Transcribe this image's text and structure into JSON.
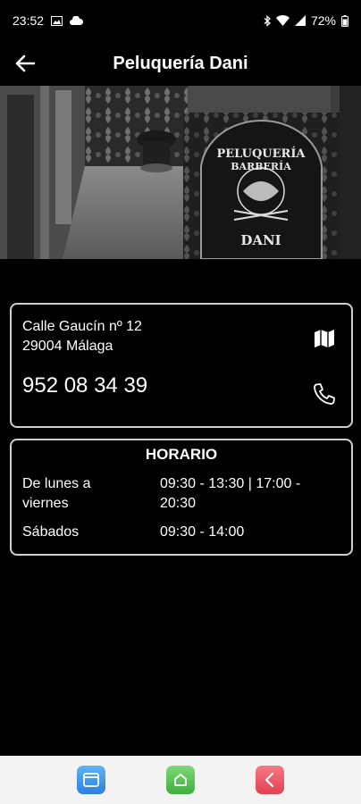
{
  "status_bar": {
    "time": "23:52",
    "battery": "72%",
    "icons": [
      "image-icon",
      "cloud-icon",
      "bluetooth-icon",
      "wifi-icon",
      "signal-icon",
      "battery-icon"
    ]
  },
  "app_bar": {
    "title": "Peluquería Dani",
    "back_icon": "arrow-left-icon"
  },
  "hero": {
    "sign_line1": "PELUQUERÍA",
    "sign_line2": "BARBERÍA",
    "sign_name": "DANI"
  },
  "contact": {
    "address_line1": "Calle Gaucín nº 12",
    "address_line2": "29004 Málaga",
    "phone": "952 08 34 39",
    "map_icon": "map-icon",
    "phone_icon": "phone-icon"
  },
  "schedule": {
    "title": "HORARIO",
    "rows": [
      {
        "day_line1": "De lunes a",
        "day_line2": "viernes",
        "hours_line1": "09:30 - 13:30 | 17:00 -",
        "hours_line2": "20:30"
      },
      {
        "day_line1": "Sábados",
        "hours_line1": "09:30 - 14:00"
      }
    ]
  },
  "bottom_nav": {
    "items": [
      "recents-icon",
      "home-icon",
      "back-icon"
    ],
    "colors": {
      "recents": "#3f8fe8",
      "home": "#4cb84a",
      "back": "#e8505d"
    }
  }
}
